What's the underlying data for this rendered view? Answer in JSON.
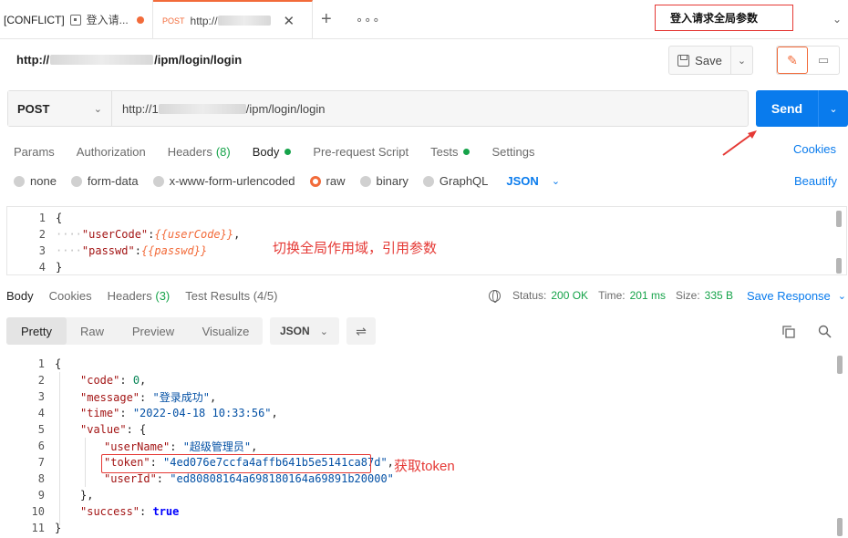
{
  "tabs": [
    {
      "prefix": "[CONFLICT]",
      "label": "登入请...",
      "unsaved": true
    },
    {
      "method": "POST",
      "label": "http://",
      "active": true
    }
  ],
  "annotations": {
    "top": "登入请求全局参数",
    "scope": "切换全局作用域，引用参数",
    "token": "获取token"
  },
  "request_title": {
    "prefix": "http://",
    "suffix": "/ipm/login/login"
  },
  "toolbar": {
    "save_label": "Save"
  },
  "request": {
    "method": "POST",
    "url_prefix": "http://1",
    "url_suffix": "/ipm/login/login",
    "send_label": "Send"
  },
  "request_tabs": [
    {
      "label": "Params"
    },
    {
      "label": "Authorization"
    },
    {
      "label": "Headers",
      "count": "(8)"
    },
    {
      "label": "Body",
      "dot": true,
      "active": true
    },
    {
      "label": "Pre-request Script"
    },
    {
      "label": "Tests",
      "dot": true
    },
    {
      "label": "Settings"
    }
  ],
  "cookies_label": "Cookies",
  "body_types": [
    "none",
    "form-data",
    "x-www-form-urlencoded",
    "raw",
    "binary",
    "GraphQL"
  ],
  "body_type_selected": "raw",
  "body_format": "JSON",
  "beautify_label": "Beautify",
  "request_body": {
    "line_numbers": [
      "1",
      "2",
      "3",
      "4"
    ],
    "open": "{",
    "key1": "\"userCode\"",
    "val1": "{{userCode}}",
    "key2": "\"passwd\"",
    "val2": "{{passwd}}",
    "close": "}"
  },
  "response_tabs": [
    {
      "label": "Body",
      "active": true
    },
    {
      "label": "Cookies"
    },
    {
      "label": "Headers",
      "count": "(3)"
    },
    {
      "label": "Test Results",
      "count": "(4/5)"
    }
  ],
  "response_status": {
    "status_label": "Status:",
    "status": "200 OK",
    "time_label": "Time:",
    "time": "201 ms",
    "size_label": "Size:",
    "size": "335 B"
  },
  "save_response_label": "Save Response",
  "view_modes": [
    "Pretty",
    "Raw",
    "Preview",
    "Visualize"
  ],
  "view_mode_selected": "Pretty",
  "response_format": "JSON",
  "response_body": {
    "line_numbers": [
      "1",
      "2",
      "3",
      "4",
      "5",
      "6",
      "7",
      "8",
      "9",
      "10",
      "11"
    ],
    "code_key": "\"code\"",
    "code_val": "0",
    "message_key": "\"message\"",
    "message_val": "\"登录成功\"",
    "time_key": "\"time\"",
    "time_val": "\"2022-04-18 10:33:56\"",
    "value_key": "\"value\"",
    "userName_key": "\"userName\"",
    "userName_val": "\"超级管理员\"",
    "token_key": "\"token\"",
    "token_val": "\"4ed076e7ccfa4affb641b5e5141ca87d\"",
    "userId_key": "\"userId\"",
    "userId_val": "\"ed80808164a698180164a69891b20000\"",
    "success_key": "\"success\"",
    "success_val": "true"
  }
}
